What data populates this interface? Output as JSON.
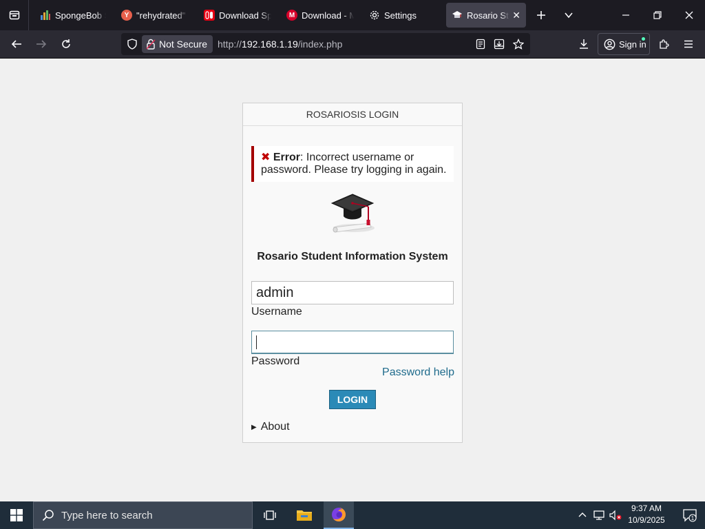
{
  "browser": {
    "tabs": [
      {
        "title": "SpongeBob Sc",
        "favicon": "bar-chart-favicon",
        "active": false
      },
      {
        "title": "\"rehydrated\" \"",
        "favicon": "y-favicon",
        "active": false
      },
      {
        "title": "Download Spo",
        "favicon": "nintendo-favicon",
        "active": false
      },
      {
        "title": "Download - M",
        "favicon": "m-favicon",
        "active": false
      },
      {
        "title": "Settings",
        "favicon": "gear-icon",
        "active": false
      },
      {
        "title": "Rosario Stuc",
        "favicon": "graduation-cap-favicon",
        "active": true
      }
    ],
    "security_label": "Not Secure",
    "url_prefix": "http://",
    "url_host": "192.168.1.19",
    "url_path": "/index.php",
    "sign_in_label": "Sign in"
  },
  "login": {
    "header": "ROSARIOSIS LOGIN",
    "error_title": "Error",
    "error_message": ": Incorrect username or password. Please try logging in again.",
    "system_name": "Rosario Student Information System",
    "username_value": "admin",
    "username_label": "Username",
    "password_value": "",
    "password_label": "Password",
    "password_help": "Password help",
    "login_button": "LOGIN",
    "about": "About"
  },
  "taskbar": {
    "search_placeholder": "Type here to search",
    "time": "9:37 AM",
    "date": "10/9/2025",
    "notification_count": "1"
  },
  "colors": {
    "accent_button": "#2b8ab7",
    "error_border": "#a40000",
    "link": "#1f6b8c"
  }
}
